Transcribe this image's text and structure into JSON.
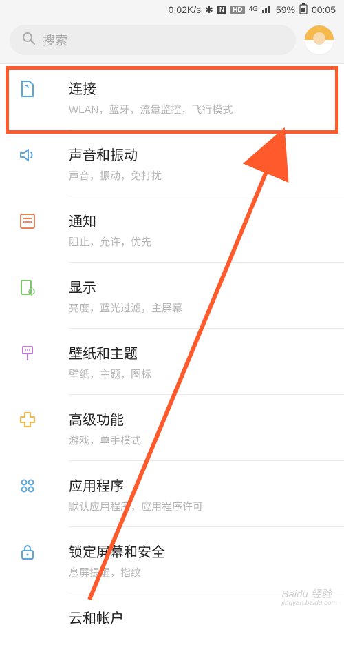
{
  "status_bar": {
    "speed": "0.02K/s",
    "bluetooth_icon": "✱",
    "nfc": "N",
    "hd": "HD",
    "net_label": "4G",
    "battery_percent": "59%",
    "time": "00:05"
  },
  "search": {
    "placeholder": "搜索"
  },
  "settings": [
    {
      "id": "connections",
      "title": "连接",
      "subtitle": "WLAN，蓝牙，流量监控，飞行模式",
      "icon": "sim-icon",
      "color": "#5aa8e0"
    },
    {
      "id": "sound",
      "title": "声音和振动",
      "subtitle": "声音，振动，免打扰",
      "icon": "speaker-icon",
      "color": "#5aa8e0"
    },
    {
      "id": "notifications",
      "title": "通知",
      "subtitle": "阻止，允许，优先",
      "icon": "list-icon",
      "color": "#f0805a"
    },
    {
      "id": "display",
      "title": "显示",
      "subtitle": "亮度，蓝光过滤，主屏幕",
      "icon": "display-icon",
      "color": "#7fc66e"
    },
    {
      "id": "wallpaper",
      "title": "壁纸和主题",
      "subtitle": "壁纸，主题，图标",
      "icon": "brush-icon",
      "color": "#b97fd6"
    },
    {
      "id": "advanced",
      "title": "高级功能",
      "subtitle": "游戏，单手模式",
      "icon": "plus-icon",
      "color": "#f2b94a"
    },
    {
      "id": "apps",
      "title": "应用程序",
      "subtitle": "默认应用程序，应用程序许可",
      "icon": "apps-icon",
      "color": "#5aa8e0"
    },
    {
      "id": "lock",
      "title": "锁定屏幕和安全",
      "subtitle": "息屏提醒，指纹",
      "icon": "lock-icon",
      "color": "#5aa8e0"
    },
    {
      "id": "cloud",
      "title": "云和帐户",
      "subtitle": "",
      "icon": "cloud-icon",
      "color": "#5aa8e0"
    }
  ],
  "annotation": {
    "highlight_color": "#ff5a2b"
  },
  "watermark": {
    "main": "Baidu 经验",
    "sub": "jingyan.baidu.com"
  }
}
